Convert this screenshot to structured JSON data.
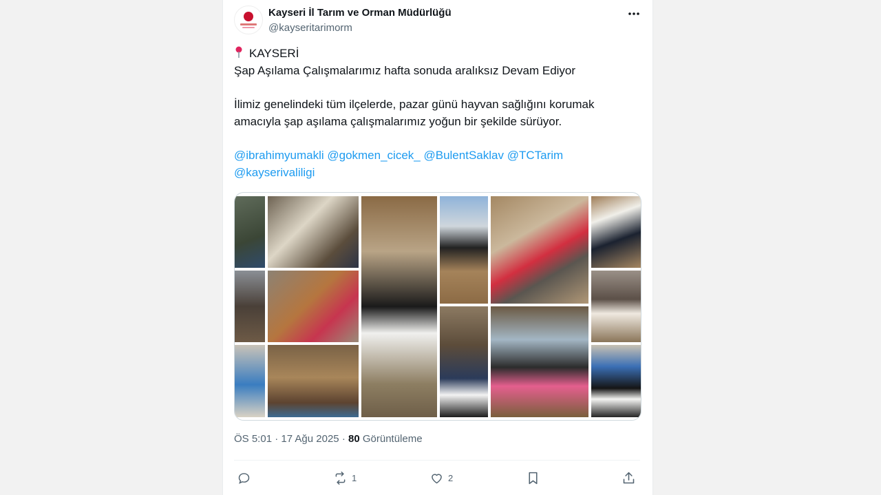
{
  "account": {
    "display_name": "Kayseri İl Tarım ve Orman Müdürlüğü",
    "handle": "@kayseritarimorm"
  },
  "tweet": {
    "location_line": "KAYSERİ",
    "headline": "Şap Aşılama Çalışmalarımız hafta sonuda aralıksız Devam Ediyor",
    "body_line1": "İlimiz genelindeki tüm ilçelerde, pazar günü hayvan sağlığını korumak",
    "body_line2": "amacıyla şap aşılama çalışmalarımız yoğun bir şekilde sürüyor.",
    "mentions": [
      "@ibrahimyumakli",
      "@gokmen_cicek_",
      "@BulentSaklav",
      "@TCTarim",
      "@kayserivaliligi"
    ]
  },
  "meta": {
    "time": "ÖS 5:01",
    "date": "17 Ağu 2025",
    "views_count": "80",
    "views_label": "Görüntüleme"
  },
  "actions": {
    "reply_count": "",
    "retweet_count": "1",
    "like_count": "2"
  },
  "icons": {
    "more": "more-icon",
    "pin": "pin-icon",
    "reply": "reply-icon",
    "retweet": "retweet-icon",
    "like": "like-icon",
    "bookmark": "bookmark-icon",
    "share": "share-icon"
  },
  "colors": {
    "mention": "#1d9bf0",
    "secondary_text": "#536471",
    "brand_red": "#c8102e"
  }
}
